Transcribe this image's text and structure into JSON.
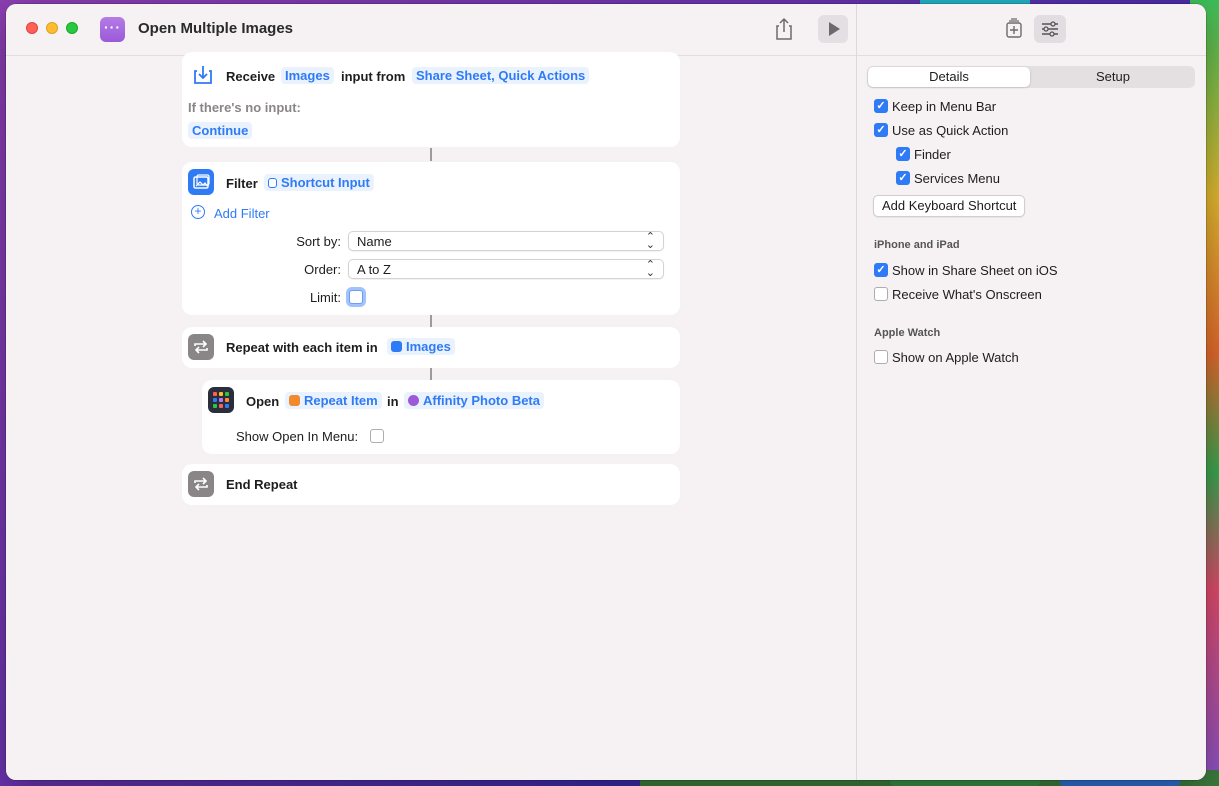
{
  "window": {
    "title": "Open Multiple Images"
  },
  "actions": {
    "receive": {
      "label": "Receive",
      "type_token": "Images",
      "input_from": "input from",
      "sources_token": "Share Sheet, Quick Actions",
      "no_input_label": "If there's no input:",
      "no_input_action": "Continue"
    },
    "filter": {
      "label": "Filter",
      "input_token": "Shortcut Input",
      "add_filter": "Add Filter",
      "sort_by_label": "Sort by:",
      "sort_by_value": "Name",
      "order_label": "Order:",
      "order_value": "A to Z",
      "limit_label": "Limit:"
    },
    "repeat": {
      "label": "Repeat with each item in",
      "token": "Images"
    },
    "open": {
      "label": "Open",
      "item_token": "Repeat Item",
      "in_label": "in",
      "app_token": "Affinity Photo Beta",
      "show_menu_label": "Show Open In Menu:"
    },
    "end_repeat": {
      "label": "End Repeat"
    }
  },
  "sidebar": {
    "tabs": [
      "Details",
      "Setup"
    ],
    "options": {
      "keep_in_menu_bar": "Keep in Menu Bar",
      "use_as_quick_action": "Use as Quick Action",
      "finder": "Finder",
      "services_menu": "Services Menu",
      "add_keyboard_shortcut": "Add Keyboard Shortcut"
    },
    "iphone_section": {
      "title": "iPhone and iPad",
      "show_share_sheet": "Show in Share Sheet on iOS",
      "receive_onscreen": "Receive What's Onscreen"
    },
    "watch_section": {
      "title": "Apple Watch",
      "show_on_watch": "Show on Apple Watch"
    }
  },
  "colors": {
    "accent": "#2f7bf6",
    "receive_icon": "#2f7bf6",
    "filter_icon": "#2f7bf6",
    "repeat_icon": "#8a8688",
    "open_icon": "#2a2d3a"
  }
}
